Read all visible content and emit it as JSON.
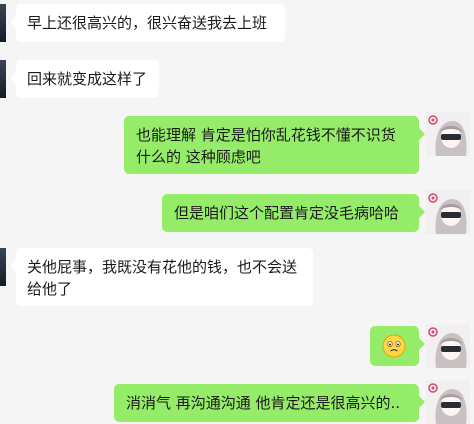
{
  "messages": [
    {
      "side": "left",
      "text": "早上还很高兴的，很兴奋送我去上班"
    },
    {
      "side": "left",
      "text": "回来就变成这样了"
    },
    {
      "side": "right",
      "lines": [
        "也能理解 肯定是怕你乱花钱不懂不识货",
        "什么的 这种顾虑吧"
      ]
    },
    {
      "side": "right",
      "text": "但是咱们这个配置肯定没毛病哈哈"
    },
    {
      "side": "left",
      "lines": [
        "关他屁事，我既没有花他的钱，也不会送",
        "给他了"
      ]
    },
    {
      "side": "right",
      "emoji": "worried-face-emoji"
    },
    {
      "side": "right",
      "text": "消消气 再沟通沟通 他肯定还是很高兴的.."
    }
  ],
  "colors": {
    "background": "#f5f5f5",
    "incoming_bubble": "#ffffff",
    "outgoing_bubble": "#95ec69"
  },
  "icons": {
    "contact_avatar": "dark-avatar",
    "self_avatar": "anime-girl-avatar"
  }
}
